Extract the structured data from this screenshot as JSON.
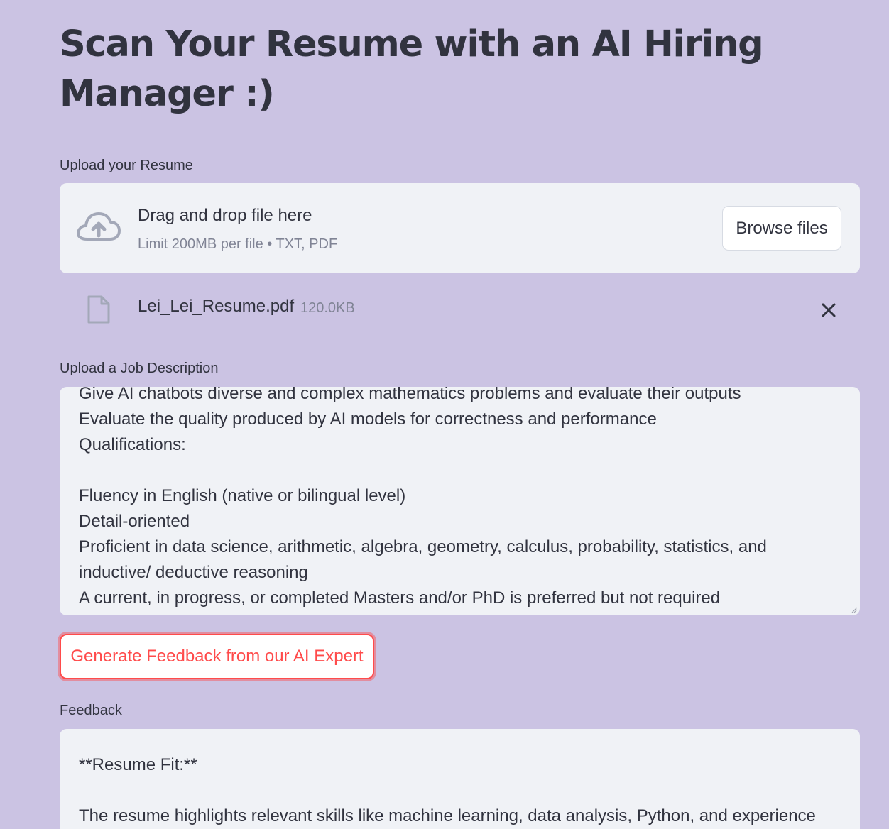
{
  "page": {
    "title": "Scan Your Resume with an AI Hiring Manager :)"
  },
  "resume_upload": {
    "label": "Upload your Resume",
    "drop_text": "Drag and drop file here",
    "hint": "Limit 200MB per file • TXT, PDF",
    "browse_label": "Browse files",
    "file": {
      "name": "Lei_Lei_Resume.pdf",
      "size": "120.0KB"
    }
  },
  "job_description": {
    "label": "Upload a Job Description",
    "value": "Give AI chatbots diverse and complex mathematics problems and evaluate their outputs\nEvaluate the quality produced by AI models for correctness and performance\nQualifications:\n\nFluency in English (native or bilingual level)\nDetail-oriented\nProficient in data science, arithmetic, algebra, geometry, calculus, probability, statistics, and inductive/ deductive reasoning\nA current, in progress, or completed Masters and/or PhD is preferred but not required"
  },
  "actions": {
    "generate_label": "Generate Feedback from our AI Expert"
  },
  "feedback": {
    "label": "Feedback",
    "value": "**Resume Fit:**\n\nThe resume highlights relevant skills like machine learning, data analysis, Python, and experience"
  },
  "icons": {
    "upload": "cloud-upload-icon",
    "file": "file-icon",
    "close": "close-icon"
  },
  "colors": {
    "background": "#cbc3e3",
    "surface": "#f0f2f6",
    "text": "#31333f",
    "muted": "#808495",
    "accent": "#ff4b4b"
  }
}
